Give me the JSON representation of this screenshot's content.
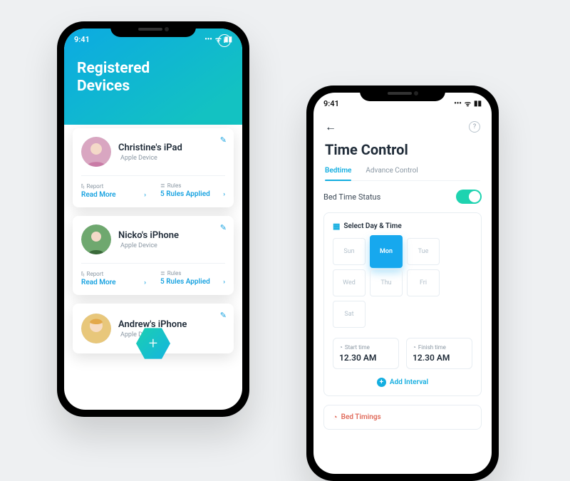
{
  "status_time": "9:41",
  "left": {
    "title_line1": "Registered",
    "title_line2": "Devices",
    "devices": [
      {
        "name": "Christine's iPad",
        "type": "Apple Device",
        "report_label": "Report",
        "read_more": "Read More",
        "rules_label": "Rules",
        "rules_value": "5 Rules Applied"
      },
      {
        "name": "Nicko's iPhone",
        "type": "Apple Device",
        "report_label": "Report",
        "read_more": "Read More",
        "rules_label": "Rules",
        "rules_value": "5 Rules Applied"
      },
      {
        "name": "Andrew's iPhone",
        "type": "Apple Device"
      }
    ]
  },
  "right": {
    "title": "Time Control",
    "tab_bedtime": "Bedtime",
    "tab_advance": "Advance Control",
    "status_label": "Bed Time Status",
    "status_on": true,
    "select_label": "Select Day & Time",
    "days": [
      "Sun",
      "Mon",
      "Tue",
      "Wed",
      "Thu",
      "Fri",
      "Sat"
    ],
    "active_day": "Mon",
    "start_label": "Start time",
    "start_value": "12.30 AM",
    "finish_label": "Finish time",
    "finish_value": "12.30 AM",
    "add_interval": "Add Interval",
    "bed_timings": "Bed Timings"
  }
}
